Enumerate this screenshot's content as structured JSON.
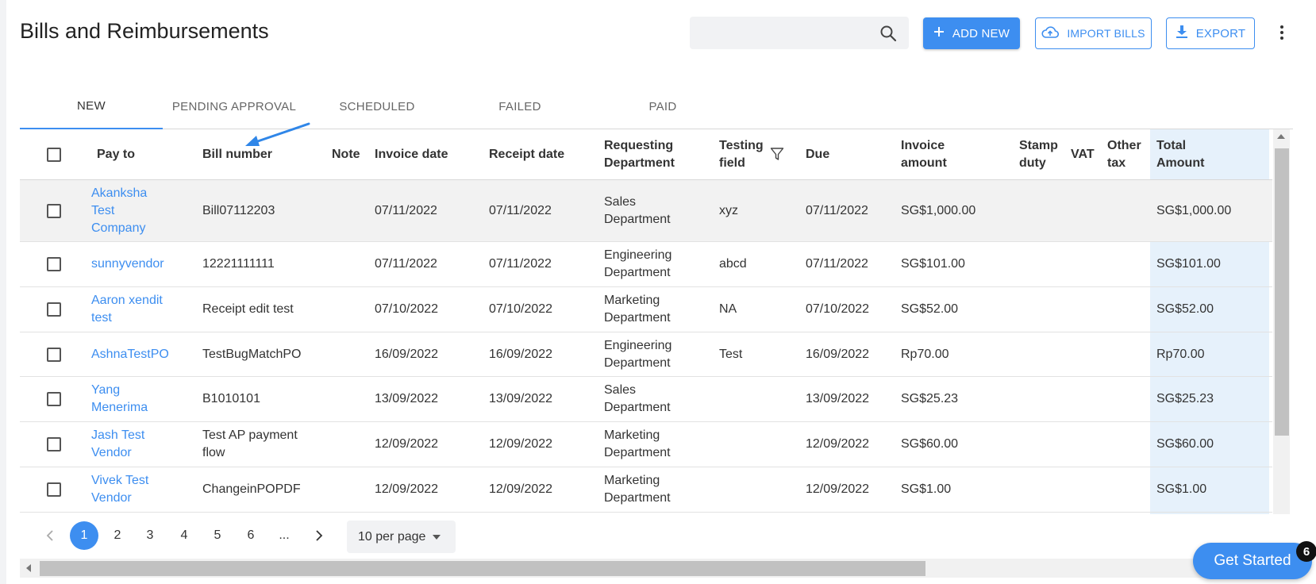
{
  "page": {
    "title": "Bills and Reimbursements"
  },
  "search": {
    "value": "",
    "placeholder": ""
  },
  "toolbar": {
    "add_new": "ADD NEW",
    "import_bills": "IMPORT BILLS",
    "export": "EXPORT"
  },
  "tabs": [
    {
      "label": "NEW",
      "active": true
    },
    {
      "label": "PENDING APPROVAL",
      "active": false
    },
    {
      "label": "SCHEDULED",
      "active": false
    },
    {
      "label": "FAILED",
      "active": false
    },
    {
      "label": "PAID",
      "active": false
    }
  ],
  "table": {
    "headers": {
      "pay_to": "Pay to",
      "bill_number": "Bill number",
      "note": "Note",
      "invoice_date": "Invoice date",
      "receipt_date": "Receipt date",
      "requesting_department": "Requesting Department",
      "testing_field": "Testing field",
      "due": "Due",
      "invoice_amount": "Invoice amount",
      "stamp_duty": "Stamp duty",
      "vat": "VAT",
      "other_tax": "Other tax",
      "total_amount": "Total Amount"
    },
    "rows": [
      {
        "pay_to": "Akanksha Test Company",
        "bill_number": "Bill07112203",
        "note": "",
        "invoice_date": "07/11/2022",
        "receipt_date": "07/11/2022",
        "department": "Sales Department",
        "testing_field": "xyz",
        "due": "07/11/2022",
        "invoice_amount": "SG$1,000.00",
        "stamp_duty": "",
        "vat": "",
        "other_tax": "",
        "total_amount": "SG$1,000.00"
      },
      {
        "pay_to": "sunnyvendor",
        "bill_number": "12221111111",
        "note": "",
        "invoice_date": "07/11/2022",
        "receipt_date": "07/11/2022",
        "department": "Engineering Department",
        "testing_field": "abcd",
        "due": "07/11/2022",
        "invoice_amount": "SG$101.00",
        "stamp_duty": "",
        "vat": "",
        "other_tax": "",
        "total_amount": "SG$101.00"
      },
      {
        "pay_to": "Aaron xendit test",
        "bill_number": "Receipt edit test",
        "note": "",
        "invoice_date": "07/10/2022",
        "receipt_date": "07/10/2022",
        "department": "Marketing Department",
        "testing_field": "NA",
        "due": "07/10/2022",
        "invoice_amount": "SG$52.00",
        "stamp_duty": "",
        "vat": "",
        "other_tax": "",
        "total_amount": "SG$52.00"
      },
      {
        "pay_to": "AshnaTestPO",
        "bill_number": "TestBugMatchPO",
        "note": "",
        "invoice_date": "16/09/2022",
        "receipt_date": "16/09/2022",
        "department": "Engineering Department",
        "testing_field": "Test",
        "due": "16/09/2022",
        "invoice_amount": "Rp70.00",
        "stamp_duty": "",
        "vat": "",
        "other_tax": "",
        "total_amount": "Rp70.00"
      },
      {
        "pay_to": "Yang Menerima",
        "bill_number": "B1010101",
        "note": "",
        "invoice_date": "13/09/2022",
        "receipt_date": "13/09/2022",
        "department": "Sales Department",
        "testing_field": "",
        "due": "13/09/2022",
        "invoice_amount": "SG$25.23",
        "stamp_duty": "",
        "vat": "",
        "other_tax": "",
        "total_amount": "SG$25.23"
      },
      {
        "pay_to": "Jash Test Vendor",
        "bill_number": "Test AP payment flow",
        "note": "",
        "invoice_date": "12/09/2022",
        "receipt_date": "12/09/2022",
        "department": "Marketing Department",
        "testing_field": "",
        "due": "12/09/2022",
        "invoice_amount": "SG$60.00",
        "stamp_duty": "",
        "vat": "",
        "other_tax": "",
        "total_amount": "SG$60.00"
      },
      {
        "pay_to": "Vivek Test Vendor",
        "bill_number": "ChangeinPOPDF",
        "note": "",
        "invoice_date": "12/09/2022",
        "receipt_date": "12/09/2022",
        "department": "Marketing Department",
        "testing_field": "",
        "due": "12/09/2022",
        "invoice_amount": "SG$1.00",
        "stamp_duty": "",
        "vat": "",
        "other_tax": "",
        "total_amount": "SG$1.00"
      }
    ]
  },
  "pagination": {
    "pages": [
      "1",
      "2",
      "3",
      "4",
      "5",
      "6",
      "..."
    ],
    "current": "1",
    "per_page": "10 per page"
  },
  "get_started": {
    "label": "Get Started",
    "badge": "6"
  },
  "colors": {
    "accent": "#3d8ef0",
    "total_column_bg": "#e6f1fb",
    "selected_row_bg": "#f2f2f2"
  },
  "icons": [
    "search-icon",
    "plus-icon",
    "cloud-upload-icon",
    "download-icon",
    "more-vert-icon",
    "filter-icon",
    "chevron-left-icon",
    "chevron-right-icon",
    "caret-down-icon"
  ]
}
